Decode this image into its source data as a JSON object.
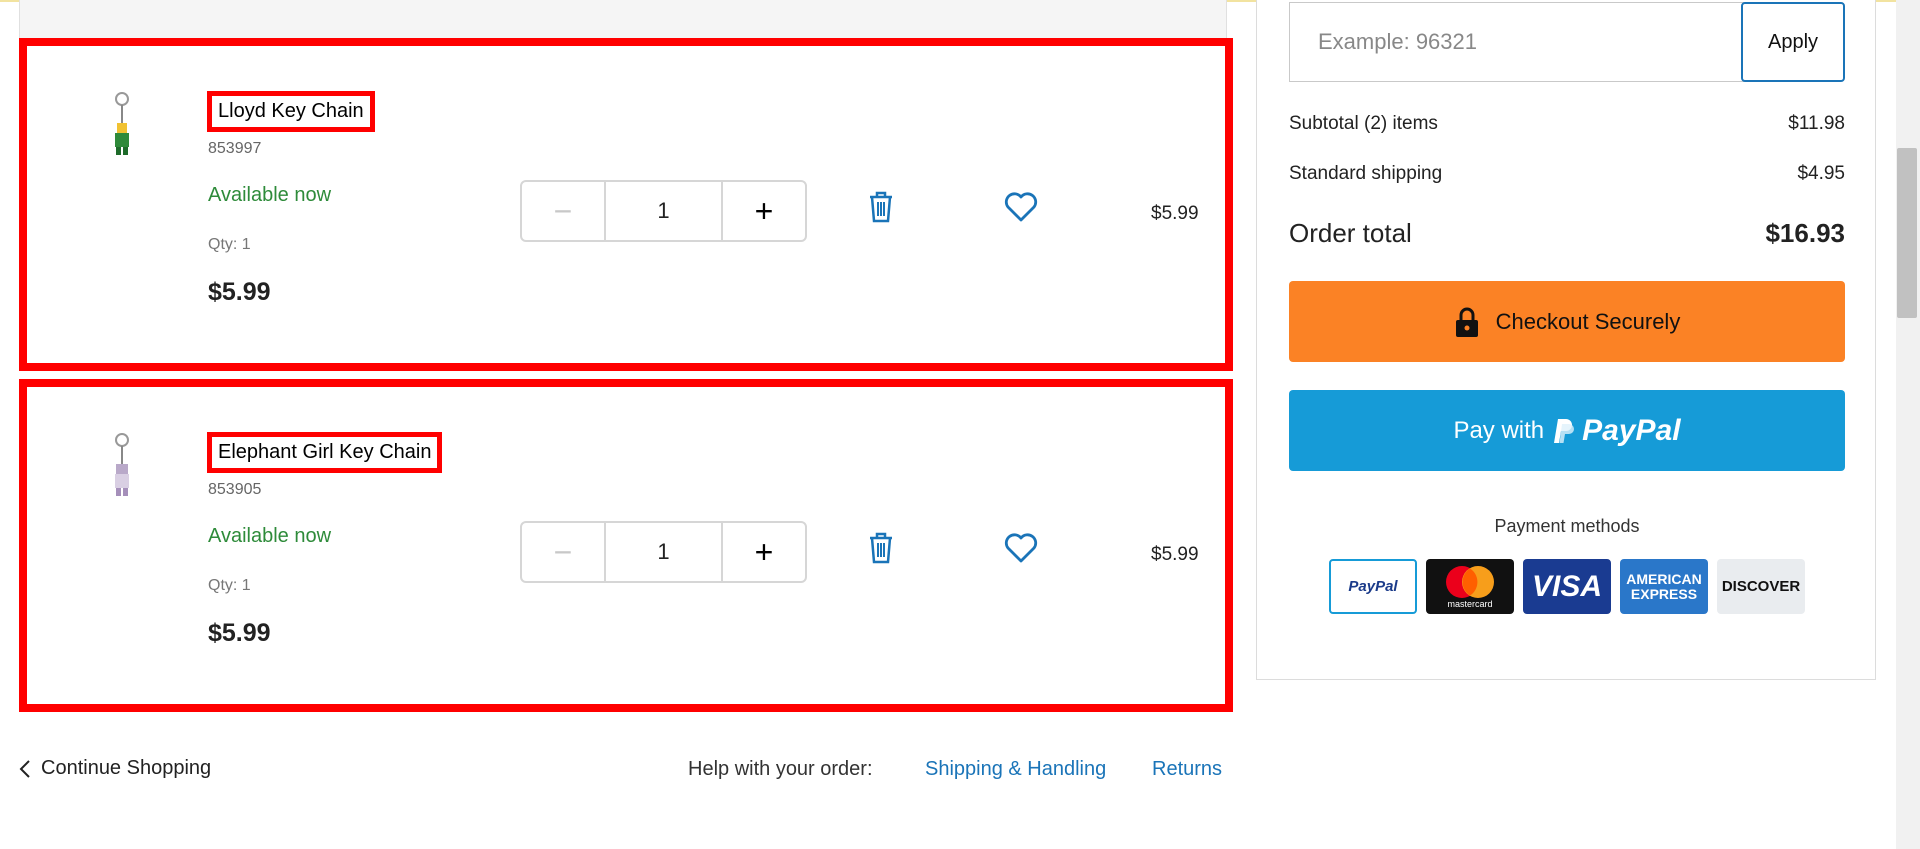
{
  "cart": {
    "items": [
      {
        "name": "Lloyd Key Chain",
        "sku": "853997",
        "availability": "Available now",
        "qty_label": "Qty: 1",
        "price": "$5.99",
        "quantity": "1",
        "line_total": "$5.99"
      },
      {
        "name": "Elephant Girl Key Chain",
        "sku": "853905",
        "availability": "Available now",
        "qty_label": "Qty: 1",
        "price": "$5.99",
        "quantity": "1",
        "line_total": "$5.99"
      }
    ],
    "stepper": {
      "minus": "−",
      "plus": "+"
    }
  },
  "footer": {
    "continue_shopping": "Continue Shopping",
    "help_label": "Help with your order:",
    "shipping_link": "Shipping & Handling",
    "returns_link": "Returns"
  },
  "summary": {
    "promo_placeholder": "Example: 96321",
    "apply_label": "Apply",
    "subtotal_label": "Subtotal (2) items",
    "subtotal_value": "$11.98",
    "shipping_label": "Standard shipping",
    "shipping_value": "$4.95",
    "total_label": "Order total",
    "total_value": "$16.93",
    "checkout_label": "Checkout Securely",
    "paypal_prefix": "Pay with",
    "paypal_brand": "PayPal",
    "payment_methods_label": "Payment methods",
    "cards": {
      "paypal": "PayPal",
      "mastercard": "mastercard",
      "visa": "VISA",
      "amex_line1": "AMERICAN",
      "amex_line2": "EXPRESS",
      "discover": "DISCOVER"
    }
  },
  "colors": {
    "highlight": "#ff0000",
    "available": "#2e8b3a",
    "link": "#1a74b8",
    "checkout": "#fb8225",
    "paypal": "#169bd7"
  },
  "icons": [
    "keychain-thumbnail",
    "trash-icon",
    "heart-icon",
    "lock-icon",
    "chevron-left-icon",
    "paypal-p-icon"
  ]
}
